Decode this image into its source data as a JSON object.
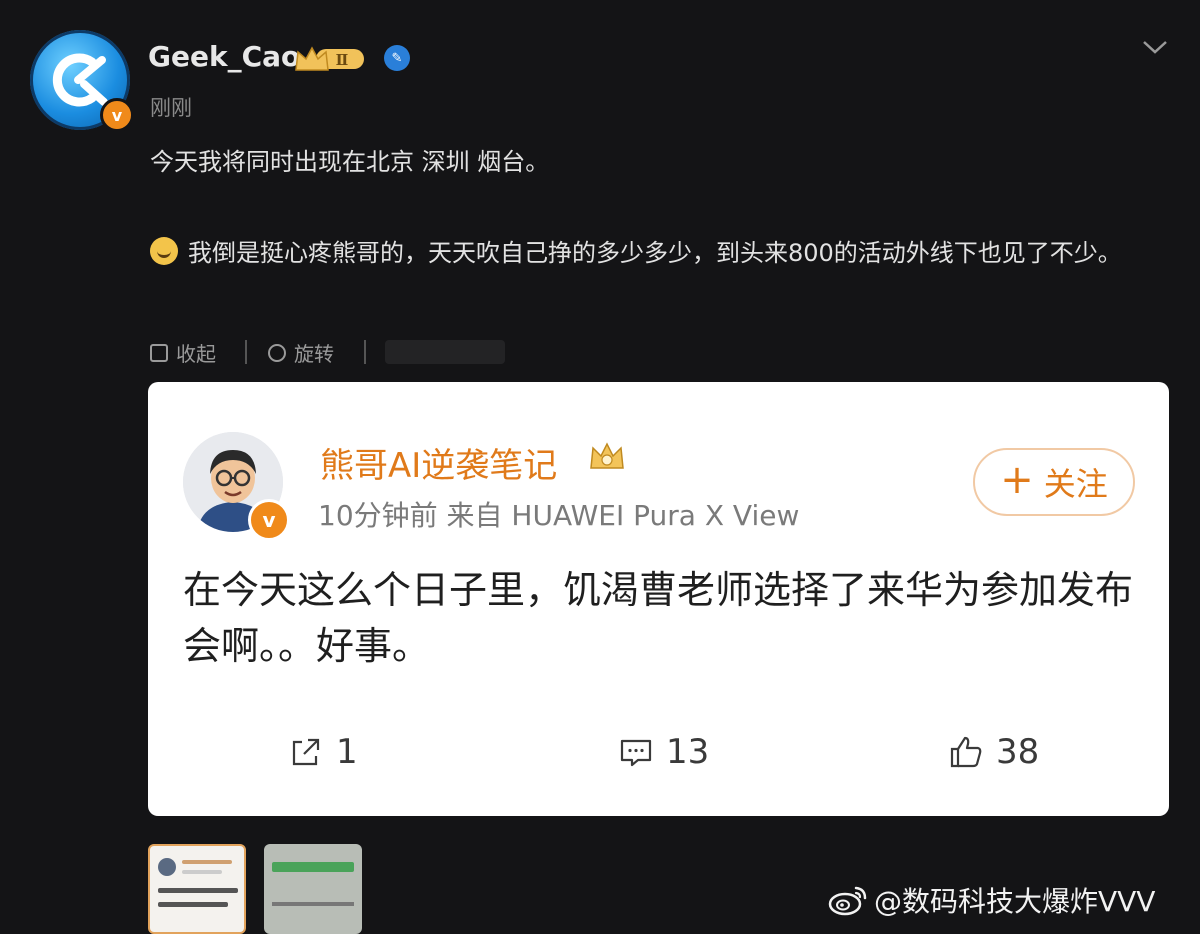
{
  "post": {
    "username": "Geek_Cao",
    "level_badge": "Ⅱ",
    "time": "刚刚",
    "line1": "今天我将同时出现在北京 深圳 烟台。",
    "line2": "我倒是挺心疼熊哥的，天天吹自己挣的多少多少，到头来800的活动外线下也见了不少。",
    "actions": {
      "collapse": "收起",
      "rotate": "旋转"
    }
  },
  "card": {
    "name": "熊哥AI逆袭笔记",
    "meta": "10分钟前  来自 HUAWEI Pura X View",
    "follow": "关注",
    "follow_plus": "+",
    "text": "在今天这么个日子里，饥渴曹老师选择了来华为参加发布会啊。。好事。",
    "stats": {
      "repost": "1",
      "comment": "13",
      "like": "38"
    }
  },
  "watermark": "@数码科技大爆炸VVV",
  "colors": {
    "accent": "#e07a1a",
    "background": "#141416",
    "card": "#ffffff"
  }
}
